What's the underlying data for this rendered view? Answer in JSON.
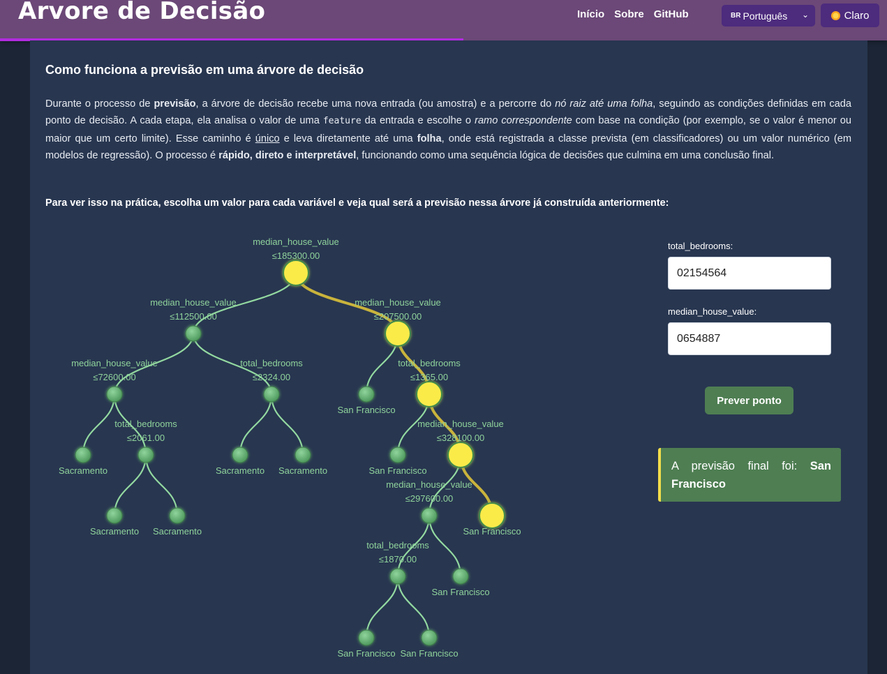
{
  "header": {
    "title": "Árvore de Decisão",
    "nav": [
      "Início",
      "Sobre",
      "GitHub"
    ],
    "language": {
      "flag": "BR",
      "label": "Português"
    },
    "theme_button": "Claro"
  },
  "main": {
    "section_title": "Como funciona a previsão em uma árvore de decisão",
    "intro": {
      "p1": "Durante o processo de ",
      "b1": "previsão",
      "p2": ", a árvore de decisão recebe uma nova entrada (ou amostra) e a percorre do ",
      "i1": "nó raiz até uma folha",
      "p3": ", seguindo as condições definidas em cada ponto de decisão. A cada etapa, ela analisa o valor de uma ",
      "code1": "feature",
      "p4": " da entrada e escolhe o ",
      "i2": "ramo correspondente",
      "p5": " com base na condição (por exemplo, se o valor é menor ou maior que um certo limite). Esse caminho é ",
      "u1": "único",
      "p6": " e leva diretamente até uma ",
      "b2": "folha",
      "p7": ", onde está registrada a classe prevista (em classificadores) ou um valor numérico (em modelos de regressão). O processo é ",
      "b3": "rápido, direto e interpretável",
      "p8": ", funcionando como uma sequência lógica de decisões que culmina em uma conclusão final."
    },
    "prompt": "Para ver isso na prática, escolha um valor para cada variável e veja qual será a previsão nessa árvore já construída anteriormente:"
  },
  "tree": {
    "nodes": [
      {
        "id": "n0",
        "feature": "median_house_value",
        "threshold": "≤185300.00",
        "on_path": true
      },
      {
        "id": "n1",
        "feature": "median_house_value",
        "threshold": "≤112500.00",
        "on_path": false
      },
      {
        "id": "n2",
        "feature": "median_house_value",
        "threshold": "≤207500.00",
        "on_path": true
      },
      {
        "id": "n3",
        "feature": "median_house_value",
        "threshold": "≤72600.00",
        "on_path": false
      },
      {
        "id": "n4",
        "feature": "total_bedrooms",
        "threshold": "≤2324.00",
        "on_path": false
      },
      {
        "id": "n5",
        "label": "San Francisco",
        "on_path": false
      },
      {
        "id": "n6",
        "feature": "total_bedrooms",
        "threshold": "≤1365.00",
        "on_path": true
      },
      {
        "id": "n7",
        "label": "Sacramento",
        "on_path": false
      },
      {
        "id": "n8",
        "feature": "total_bedrooms",
        "threshold": "≤2061.00",
        "on_path": false
      },
      {
        "id": "n9",
        "label": "Sacramento",
        "on_path": false
      },
      {
        "id": "n10",
        "label": "Sacramento",
        "on_path": false
      },
      {
        "id": "n11",
        "label": "San Francisco",
        "on_path": false
      },
      {
        "id": "n12",
        "feature": "median_house_value",
        "threshold": "≤328100.00",
        "on_path": true
      },
      {
        "id": "n13",
        "label": "Sacramento",
        "on_path": false
      },
      {
        "id": "n14",
        "label": "Sacramento",
        "on_path": false
      },
      {
        "id": "n15",
        "feature": "median_house_value",
        "threshold": "≤297600.00",
        "on_path": false
      },
      {
        "id": "n16",
        "label": "San Francisco",
        "on_path": true
      },
      {
        "id": "n17",
        "feature": "total_bedrooms",
        "threshold": "≤1870.00",
        "on_path": false
      },
      {
        "id": "n18",
        "label": "San Francisco",
        "on_path": false
      },
      {
        "id": "n19",
        "label": "San Francisco",
        "on_path": false
      },
      {
        "id": "n20",
        "label": "San Francisco",
        "on_path": false
      }
    ],
    "edges": [
      [
        "n0",
        "n1"
      ],
      [
        "n0",
        "n2"
      ],
      [
        "n1",
        "n3"
      ],
      [
        "n1",
        "n4"
      ],
      [
        "n2",
        "n5"
      ],
      [
        "n2",
        "n6"
      ],
      [
        "n3",
        "n7"
      ],
      [
        "n3",
        "n8"
      ],
      [
        "n4",
        "n9"
      ],
      [
        "n4",
        "n10"
      ],
      [
        "n6",
        "n11"
      ],
      [
        "n6",
        "n12"
      ],
      [
        "n8",
        "n13"
      ],
      [
        "n8",
        "n14"
      ],
      [
        "n12",
        "n15"
      ],
      [
        "n12",
        "n16"
      ],
      [
        "n15",
        "n17"
      ],
      [
        "n15",
        "n18"
      ],
      [
        "n17",
        "n19"
      ],
      [
        "n17",
        "n20"
      ]
    ]
  },
  "form": {
    "field1": {
      "label": "total_bedrooms:",
      "value": "02154564"
    },
    "field2": {
      "label": "median_house_value:",
      "value": "0654887"
    },
    "predict_button": "Prever ponto",
    "result_prefix": "A previsão final foi:",
    "result_value": "San Francisco"
  },
  "colors": {
    "header_bg": "#6b4877",
    "accent_purple": "#b22be0",
    "card_bg": "#283650",
    "node_green": "#62b071",
    "edge_green": "#93d9a0",
    "path_gold": "#c9b33c",
    "node_highlight": "#fbeb4a",
    "result_bg": "#4e7e52"
  }
}
